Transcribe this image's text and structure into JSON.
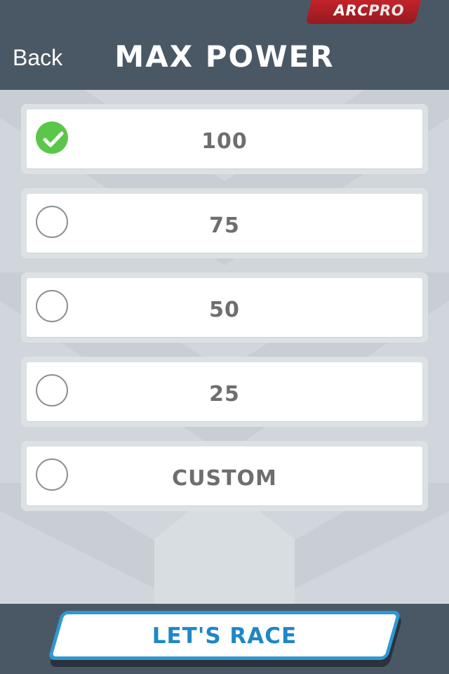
{
  "header": {
    "back_label": "Back",
    "title": "MAX POWER",
    "brand_part1": "ARC",
    "brand_part2": "PRO"
  },
  "options": [
    {
      "label": "100",
      "selected": true
    },
    {
      "label": "75",
      "selected": false
    },
    {
      "label": "50",
      "selected": false
    },
    {
      "label": "25",
      "selected": false
    },
    {
      "label": "CUSTOM",
      "selected": false
    }
  ],
  "footer": {
    "race_label": "LET'S RACE"
  },
  "colors": {
    "header_bg": "#4a5866",
    "page_bg": "#d0d6db",
    "checked_green": "#5bc74a",
    "race_blue": "#2f98d4",
    "brand_red": "#c4232a"
  }
}
